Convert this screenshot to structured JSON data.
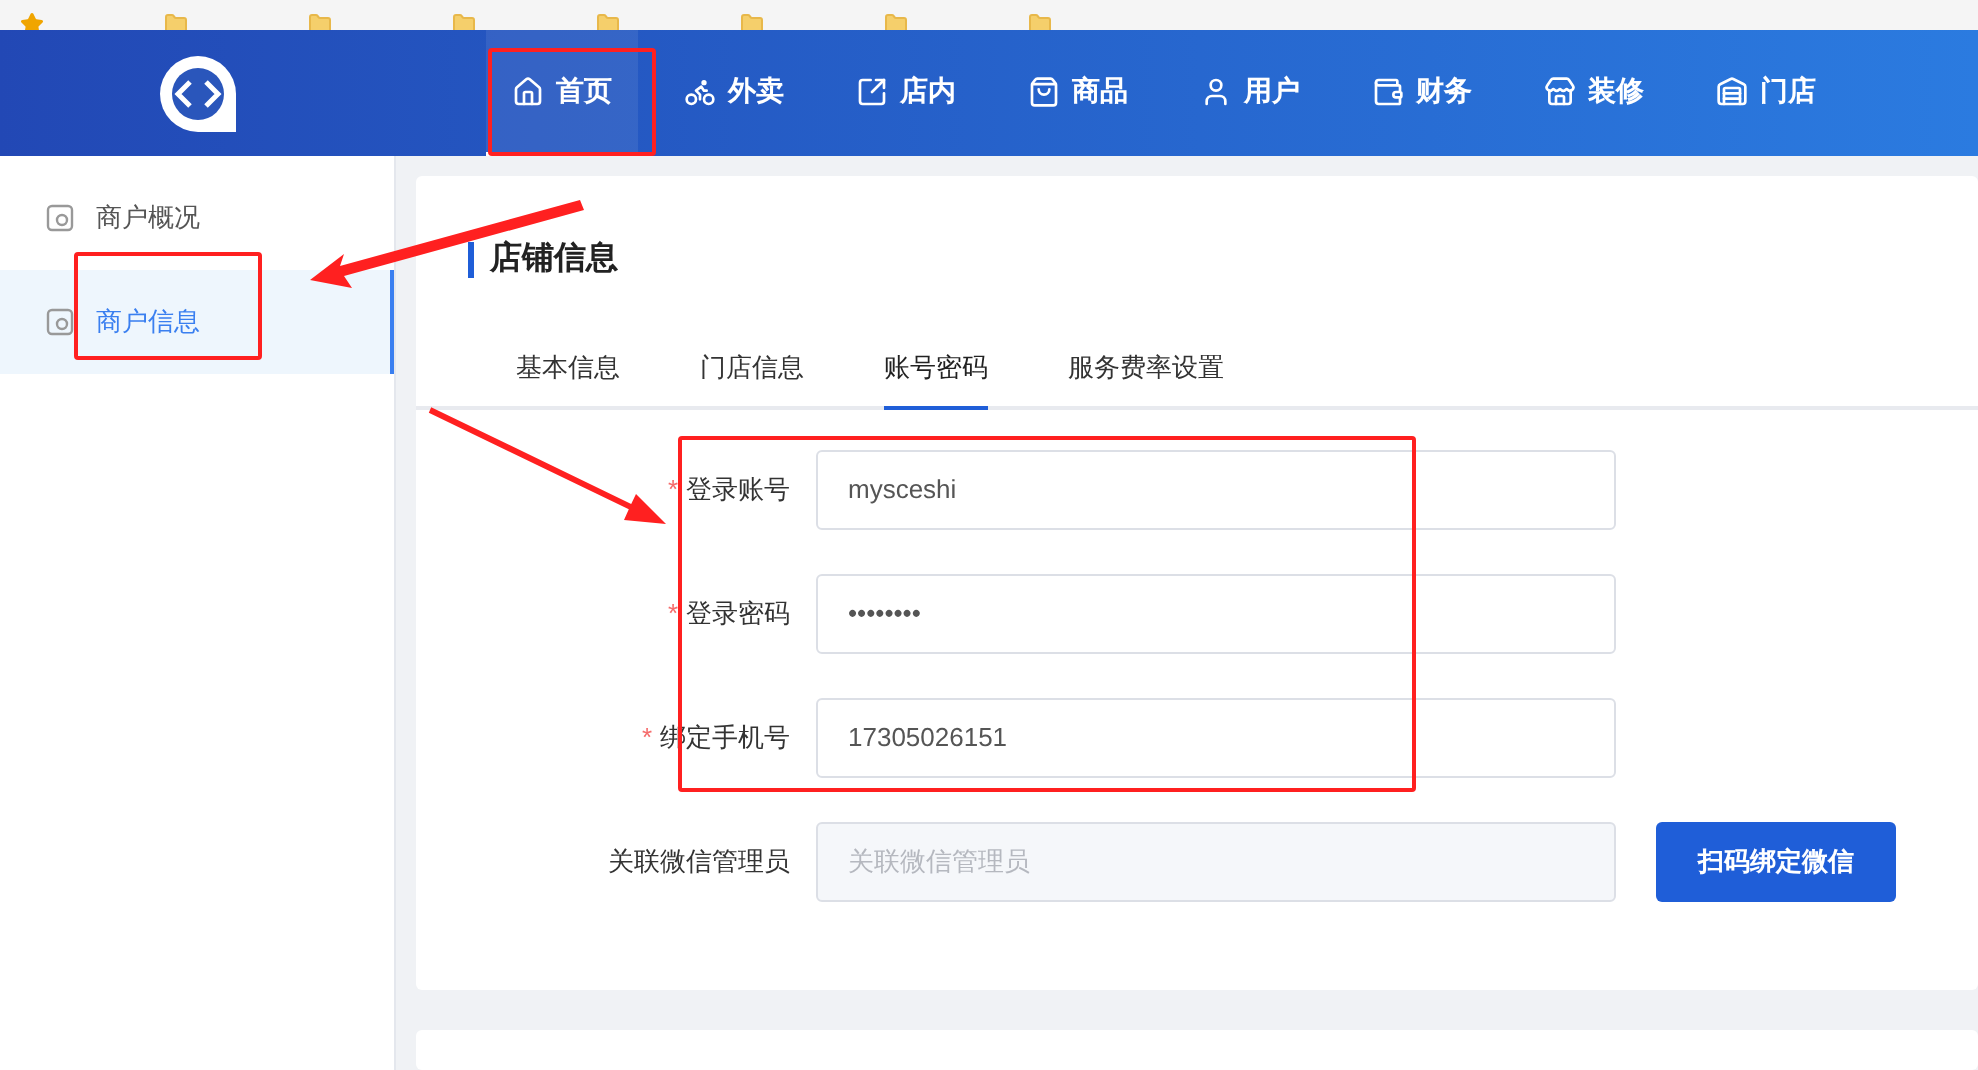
{
  "nav": [
    {
      "label": "首页",
      "selected": true
    },
    {
      "label": "外卖",
      "selected": false
    },
    {
      "label": "店内",
      "selected": false
    },
    {
      "label": "商品",
      "selected": false
    },
    {
      "label": "用户",
      "selected": false
    },
    {
      "label": "财务",
      "selected": false
    },
    {
      "label": "装修",
      "selected": false
    },
    {
      "label": "门店",
      "selected": false
    }
  ],
  "sidebar": {
    "items": [
      {
        "label": "商户概况",
        "selected": false
      },
      {
        "label": "商户信息",
        "selected": true
      }
    ]
  },
  "card": {
    "title": "店铺信息",
    "tabs": [
      {
        "label": "基本信息",
        "selected": false
      },
      {
        "label": "门店信息",
        "selected": false
      },
      {
        "label": "账号密码",
        "selected": true
      },
      {
        "label": "服务费率设置",
        "selected": false
      }
    ],
    "fields": [
      {
        "label": "登录账号",
        "required_mark": "*",
        "value": "mysceshi"
      },
      {
        "label": "登录密码",
        "required_mark": "*",
        "value": "••••••••"
      },
      {
        "label": "绑定手机号",
        "required_mark": "*",
        "value": "17305026151"
      },
      {
        "label": "关联微信管理员",
        "placeholder": "关联微信管理员",
        "button": "扫码绑定微信"
      }
    ]
  }
}
